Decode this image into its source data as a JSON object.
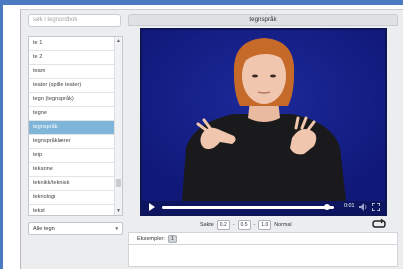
{
  "search": {
    "placeholder": "søk i tegnordbok"
  },
  "sign_list": {
    "items": [
      "te 1",
      "te 2",
      "team",
      "teater (spille teater)",
      "tegn (tegnspråk)",
      "tegne",
      "tegnspråk",
      "tegnspråklærer",
      "teip",
      "tekanne",
      "teknikk/teknisk",
      "teknologi",
      "tekst"
    ],
    "selected_index": 6
  },
  "filter": {
    "selected": "Alle tegn"
  },
  "main": {
    "title": "tegnspråk"
  },
  "video": {
    "time": "0:01",
    "progress": 0.96
  },
  "speed": {
    "label": "Sakte",
    "options": [
      "0.2",
      "0.5",
      "1.0"
    ],
    "separator": "-",
    "normal_label": "Normal"
  },
  "examples": {
    "label": "Eksempler:",
    "count": "1"
  },
  "colors": {
    "accent": "#4a7bc2",
    "selected": "#7eb5d8",
    "video_bg": "#141d7e"
  }
}
